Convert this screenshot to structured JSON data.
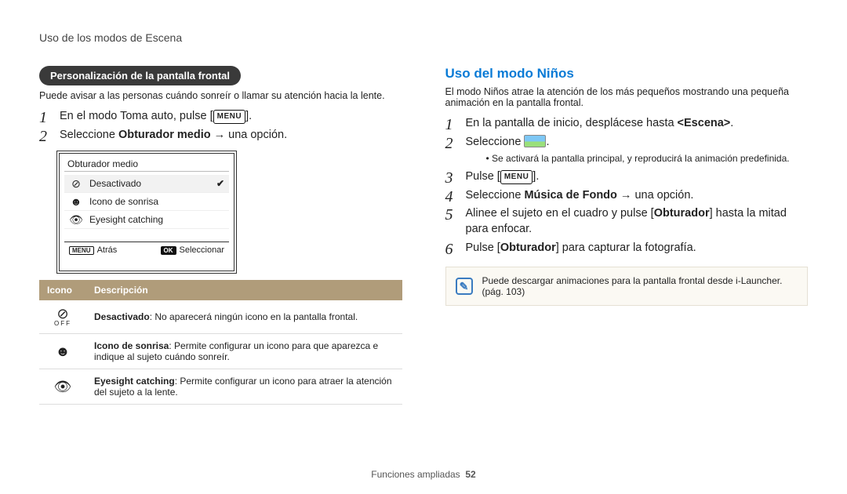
{
  "breadcrumb": "Uso de los modos de Escena",
  "left": {
    "badge": "Personalización de la pantalla frontal",
    "intro": "Puede avisar a las personas cuándo sonreír o llamar su atención hacia la lente.",
    "step1_pre": "En el modo Toma auto, pulse [",
    "step1_post": "].",
    "step2_pre": "Seleccione ",
    "step2_bold": "Obturador medio",
    "step2_post": " → una opción.",
    "menu_label": "MENU",
    "screen": {
      "title": "Obturador medio",
      "opt1": "Desactivado",
      "opt2": "Icono de sonrisa",
      "opt3": "Eyesight catching",
      "back": "Atrás",
      "select": "Seleccionar",
      "back_chip": "MENU",
      "select_chip": "OK"
    },
    "table": {
      "head_icon": "Icono",
      "head_desc": "Descripción",
      "row1_b": "Desactivado",
      "row1_t": ": No aparecerá ningún icono en la pantalla frontal.",
      "row2_b": "Icono de sonrisa",
      "row2_t": ": Permite configurar un icono para que aparezca e indique al sujeto cuándo sonreír.",
      "row3_b": "Eyesight catching",
      "row3_t": ": Permite configurar un icono para atraer la atención del sujeto a la lente."
    }
  },
  "right": {
    "heading": "Uso del modo Niños",
    "intro": "El modo Niños atrae la atención de los más pequeños mostrando una pequeña animación en la pantalla frontal.",
    "s1_pre": "En la pantalla de inicio, desplácese hasta ",
    "s1_bold": "<Escena>",
    "s1_post": ".",
    "s2_pre": "Seleccione ",
    "s2_post": ".",
    "s2_sub": "Se activará la pantalla principal, y reproducirá la animación predefinida.",
    "s3_pre": "Pulse [",
    "s3_post": "].",
    "s4_pre": "Seleccione ",
    "s4_bold": "Música de Fondo",
    "s4_post": " → una opción.",
    "s5_pre": "Alinee el sujeto en el cuadro y pulse [",
    "s5_bold": "Obturador",
    "s5_post": "] hasta la mitad para enfocar.",
    "s6_pre": "Pulse [",
    "s6_bold": "Obturador",
    "s6_post": "] para capturar la fotografía.",
    "menu_label": "MENU",
    "note": "Puede descargar animaciones para la pantalla frontal desde i-Launcher. (pág. 103)"
  },
  "footer": {
    "section": "Funciones ampliadas",
    "page": "52"
  }
}
